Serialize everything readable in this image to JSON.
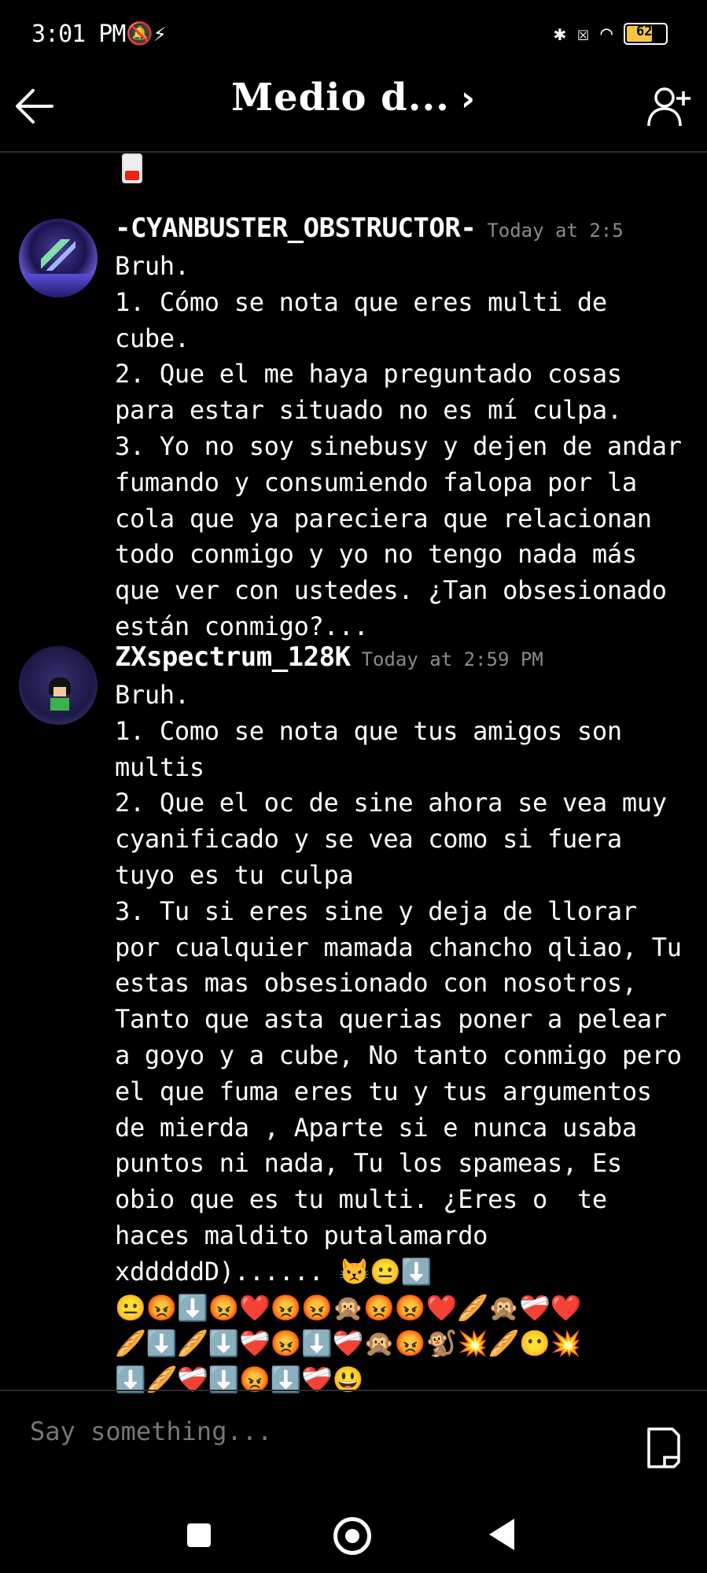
{
  "status_bar": {
    "time": "3:01 PM",
    "battery": "62"
  },
  "header": {
    "title": "Medio d...",
    "chevron": "›"
  },
  "messages": [
    {
      "username": "-CYANBUSTER_OBSTRUCTOR-",
      "timestamp": "Today at 2:5",
      "text": "Bruh.\n1. Cómo se nota que eres multi de cube.\n2. Que el me haya preguntado cosas para estar situado no es mí culpa.\n3. Yo no soy sinebusy y dejen de andar fumando y consumiendo falopa por la cola que ya pareciera que relacionan todo conmigo y yo no tengo nada más que ver con ustedes. ¿Tan obsesionado están conmigo?..."
    },
    {
      "username": "ZXspectrum_128K",
      "timestamp": "Today at 2:59 PM",
      "text": "Bruh.\n1. Como se nota que tus amigos son multis\n2. Que el oc de sine ahora se vea muy cyanificado y se vea como si fuera tuyo es tu culpa\n3. Tu si eres sine y deja de llorar por cualquier mamada chancho qliao, Tu estas mas obsesionado con nosotros, Tanto que asta querias poner a pelear a goyo y a cube, No tanto conmigo pero el que fuma eres tu y tus argumentos de mierda , Aparte si e nunca usaba puntos ni nada, Tu los spameas, Es obio que es tu multi. ¿Eres o  te haces maldito putalamardo xdddddD)...... 😾😐⬇️\n😐😡⬇️😡❤️😡😡🙊😡😡❤️🥖🙊❤️‍🩹❤️\n🥖⬇️🥖⬇️❤️‍🩹😡⬇️❤️‍🩹🙊😡🐒💥🥖😶💥\n⬇️🥖❤️‍🩹⬇️😡⬇️❤️‍🩹😃"
    }
  ],
  "input": {
    "placeholder": "Say something..."
  }
}
